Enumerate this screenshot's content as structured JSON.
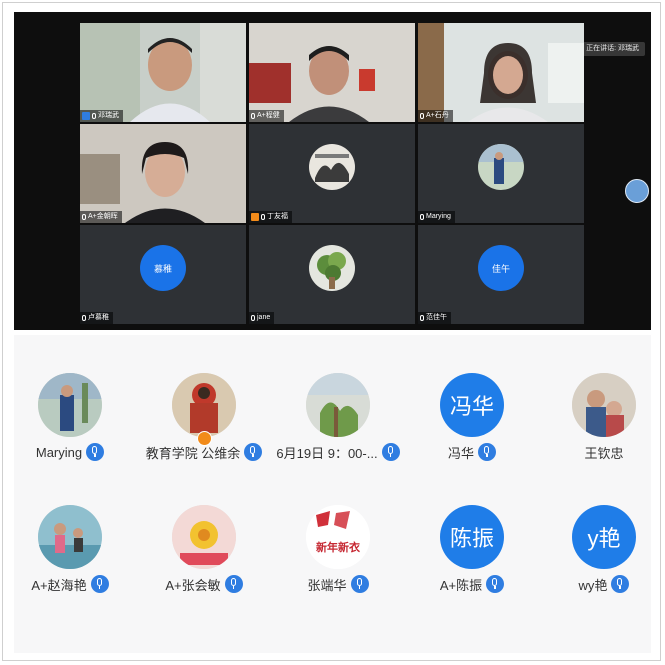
{
  "video_panel": {
    "speaking_label": "正在讲话: 邓瑞武",
    "tiles": [
      {
        "name": "邓瑞武",
        "type": "camera"
      },
      {
        "name": "A+程健",
        "type": "camera"
      },
      {
        "name": "A+石丹",
        "type": "camera"
      },
      {
        "name": "A+金朝晖",
        "type": "camera"
      },
      {
        "name": "丁友福",
        "type": "photo"
      },
      {
        "name": "Marying",
        "type": "photo"
      },
      {
        "name": "卢慕稚",
        "type": "avatar",
        "avatar_text": "慕稚"
      },
      {
        "name": "jane",
        "type": "photo"
      },
      {
        "name": "范佳午",
        "type": "avatar",
        "avatar_text": "佳午"
      }
    ]
  },
  "participants": [
    {
      "name": "Marying",
      "avatar_type": "photo",
      "mic": true
    },
    {
      "name": "教育学院 公维余",
      "avatar_type": "photo",
      "mic": true,
      "badge": true
    },
    {
      "name": "6月19日 9：00-...",
      "avatar_type": "photo",
      "mic": true
    },
    {
      "name": "冯华",
      "avatar_type": "text",
      "avatar_text": "冯华",
      "mic": true
    },
    {
      "name": "王钦忠",
      "avatar_type": "photo",
      "mic": false
    },
    {
      "name": "A+赵海艳",
      "avatar_type": "photo",
      "mic": true
    },
    {
      "name": "A+张会敏",
      "avatar_type": "photo",
      "mic": true
    },
    {
      "name": "张端华",
      "avatar_type": "photo",
      "mic": true,
      "photo_text": "新年新衣"
    },
    {
      "name": "A+陈振",
      "avatar_type": "text",
      "avatar_text": "陈振",
      "mic": true
    },
    {
      "name": "wy艳",
      "avatar_type": "text",
      "avatar_text": "y艳",
      "mic": true
    }
  ],
  "colors": {
    "accent": "#1f7de8",
    "video_bg": "#0e0e0e",
    "tile_bg": "#2e3135",
    "panel_bg": "#f7f7f8"
  }
}
